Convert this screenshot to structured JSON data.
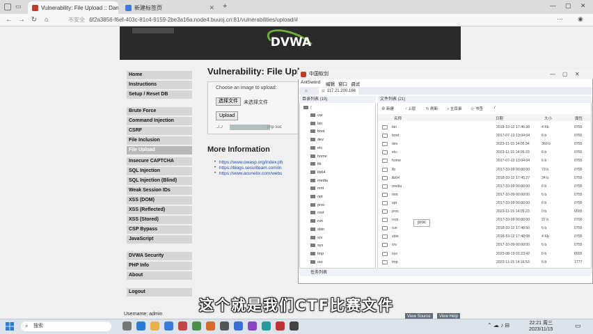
{
  "browser": {
    "tabs": [
      {
        "title": "Vulnerability: File Upload :: Dan"
      },
      {
        "title": "新建标签页"
      }
    ],
    "url": "6f2a3856-f6ef-403c-81c4-9159-2be3a16a.node4.buuoj.cn:81/vulnerabilities/upload/#",
    "url_prefix": "不安全"
  },
  "dvwa": {
    "logo": "DVWA",
    "menu": [
      "Home",
      "Instructions",
      "Setup / Reset DB",
      "Brute Force",
      "Command Injection",
      "CSRF",
      "File Inclusion",
      "File Upload",
      "Insecure CAPTCHA",
      "SQL Injection",
      "SQL Injection (Blind)",
      "Weak Session IDs",
      "XSS (DOM)",
      "XSS (Reflected)",
      "XSS (Stored)",
      "CSP Bypass",
      "JavaScript",
      "DVWA Security",
      "PHP Info",
      "About",
      "Logout"
    ],
    "title": "Vulnerability: File Uplo",
    "upload_label": "Choose an image to upload:",
    "choose_button": "选择文件",
    "no_file": "未选择文件",
    "upload_button": "Upload",
    "upload_path_prefix": "../../",
    "upload_path_suffix": ".php  suc",
    "more_info": "More Information",
    "links": [
      "https://www.owasp.org/index.ph",
      "https://blogs.securiteam.com/in",
      "https://www.acunetix.com/webs"
    ],
    "username": "Username: admin",
    "bottom_buttons": [
      "View Source",
      "View Help"
    ]
  },
  "antsword": {
    "window_title": "中国蚁剑",
    "menu": [
      "AntSword",
      "编辑",
      "窗口",
      "调试"
    ],
    "tab_home": "⌂",
    "tab_target": "117.21.200.166",
    "dir_header": "目录列表 (19)",
    "root": "/",
    "tree": [
      "var",
      "bin",
      "boot",
      "dev",
      "etc",
      "home",
      "lib",
      "lib64",
      "media",
      "mnt",
      "opt",
      "proc",
      "root",
      "run",
      "sbin",
      "srv",
      "sys",
      "tmp",
      "usr"
    ],
    "file_header": "文件列表 (21)",
    "toolbar": [
      "新建",
      "上层",
      "刷新",
      "主目录",
      "书签"
    ],
    "toolbar_path": "/",
    "columns": [
      "名称",
      "日期",
      "大小",
      "属性"
    ],
    "files": [
      {
        "name": "bin",
        "date": "2018-10-12 17:46:38",
        "size": "4 Kb",
        "attr": "0755"
      },
      {
        "name": "boot",
        "date": "2017-07-13 13:04:04",
        "size": "6 b",
        "attr": "0755"
      },
      {
        "name": "dev",
        "date": "2023-11-15 14:05:34",
        "size": "360 b",
        "attr": "0755"
      },
      {
        "name": "etc",
        "date": "2023-11-15 14:05:23",
        "size": "6 b",
        "attr": "0755"
      },
      {
        "name": "home",
        "date": "2017-07-13 13:04:04",
        "size": "6 b",
        "attr": "0755"
      },
      {
        "name": "lib",
        "date": "2017-10-09 00:00:00",
        "size": "73 b",
        "attr": "0755"
      },
      {
        "name": "lib64",
        "date": "2018-10-12 17:45:27",
        "size": "34 b",
        "attr": "0755"
      },
      {
        "name": "media",
        "date": "2017-10-09 00:00:00",
        "size": "6 b",
        "attr": "0755"
      },
      {
        "name": "mnt",
        "date": "2017-10-09 00:00:00",
        "size": "6 b",
        "attr": "0755"
      },
      {
        "name": "opt",
        "date": "2017-10-09 00:00:00",
        "size": "6 b",
        "attr": "0755"
      },
      {
        "name": "proc",
        "date": "2023-11-15 14:05:23",
        "size": "0 b",
        "attr": "0555"
      },
      {
        "name": "root",
        "date": "2017-10-09 00:00:00",
        "size": "37 b",
        "attr": "0700"
      },
      {
        "name": "run",
        "date": "2018-10-12 17:48:50",
        "size": "6 b",
        "attr": "0755"
      },
      {
        "name": "sbin",
        "date": "2018-10-12 17:48:08",
        "size": "4 Kb",
        "attr": "0755"
      },
      {
        "name": "srv",
        "date": "2017-10-09 00:00:00",
        "size": "6 b",
        "attr": "0755"
      },
      {
        "name": "sys",
        "date": "2023-08-19 01:23:42",
        "size": "0 b",
        "attr": "0555"
      },
      {
        "name": "tmp",
        "date": "2023-11-15 14:16:53",
        "size": "6 b",
        "attr": "1777"
      }
    ],
    "tooltip": "proc",
    "task_bar": "任务列表"
  },
  "subtitle": "这个就是我们CTF比赛文件",
  "taskbar": {
    "search": "搜索",
    "time": "22:21 周三",
    "date": "2023/11/15"
  },
  "colors": {
    "dvwa_header": "#2a2a2a",
    "dvwa_accent": "#6fae3b",
    "link": "#1a4ab8",
    "taskbar": "#dde3ea"
  }
}
